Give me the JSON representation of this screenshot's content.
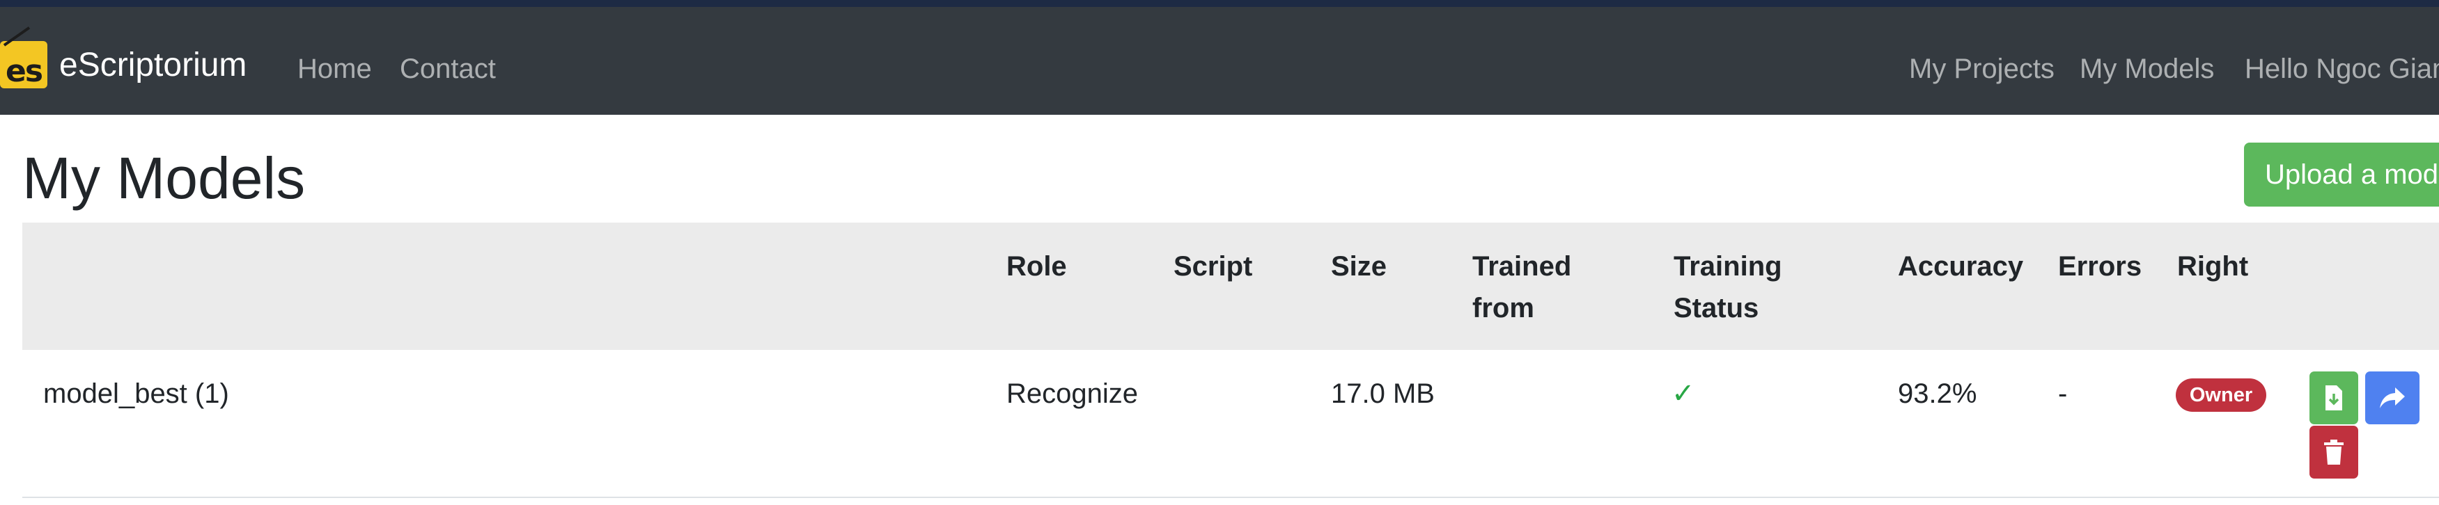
{
  "navbar": {
    "brand": "eScriptorium",
    "logo_text": "es",
    "links": [
      "Home",
      "Contact"
    ],
    "right_links": [
      "My Projects",
      "My Models",
      "Hello Ngoc Giang"
    ]
  },
  "page": {
    "title": "My Models",
    "upload_button": "Upload a model"
  },
  "table": {
    "headers": {
      "role": "Role",
      "script": "Script",
      "size": "Size",
      "trained_from": [
        "Trained",
        "from"
      ],
      "training_status": [
        "Training",
        "Status"
      ],
      "accuracy": "Accuracy",
      "errors": "Errors",
      "right": "Right"
    },
    "rows": [
      {
        "name": "model_best (1)",
        "role": "Recognize",
        "script": "",
        "size": "17.0 MB",
        "trained_from": "",
        "training_status": "✓",
        "accuracy": "93.2%",
        "errors": "-",
        "right": "Owner"
      }
    ]
  },
  "icons": {
    "download": "download-icon",
    "share": "share-icon",
    "delete": "trash-icon",
    "check": "check-icon"
  },
  "colors": {
    "navbar_bg": "#343a40",
    "success": "#5cb85c",
    "primary": "#4f81f0",
    "danger": "#c0313e",
    "check": "#28a745",
    "table_header_bg": "#ebebeb"
  }
}
